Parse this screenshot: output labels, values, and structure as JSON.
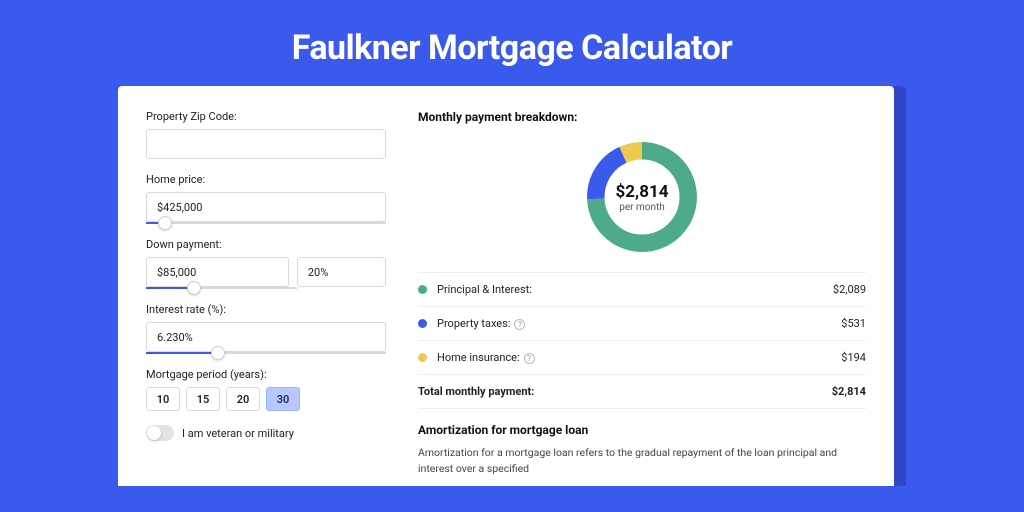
{
  "header": {
    "title": "Faulkner Mortgage Calculator"
  },
  "form": {
    "zip": {
      "label": "Property Zip Code:",
      "value": ""
    },
    "home_price": {
      "label": "Home price:",
      "value": "$425,000",
      "slider_pct": 8
    },
    "down_payment": {
      "label": "Down payment:",
      "value": "$85,000",
      "pct": "20%",
      "slider_pct": 20
    },
    "interest": {
      "label": "Interest rate (%):",
      "value": "6.230%",
      "slider_pct": 30
    },
    "period": {
      "label": "Mortgage period (years):",
      "options": [
        "10",
        "15",
        "20",
        "30"
      ],
      "selected": "30"
    },
    "veteran": {
      "label": "I am veteran or military"
    }
  },
  "breakdown": {
    "title": "Monthly payment breakdown:",
    "total": "$2,814",
    "sub": "per month",
    "items": [
      {
        "label": "Principal & Interest:",
        "value": "$2,089",
        "color": "#4eab8a",
        "info": false
      },
      {
        "label": "Property taxes:",
        "value": "$531",
        "color": "#3a59ed",
        "info": true
      },
      {
        "label": "Home insurance:",
        "value": "$194",
        "color": "#f0c94f",
        "info": true
      }
    ],
    "total_row": {
      "label": "Total monthly payment:",
      "value": "$2,814"
    }
  },
  "amort": {
    "title": "Amortization for mortgage loan",
    "text": "Amortization for a mortgage loan refers to the gradual repayment of the loan principal and interest over a specified"
  },
  "chart_data": {
    "type": "pie",
    "title": "Monthly payment breakdown",
    "categories": [
      "Principal & Interest",
      "Property taxes",
      "Home insurance"
    ],
    "values": [
      2089,
      531,
      194
    ],
    "colors": [
      "#4eab8a",
      "#3a59ed",
      "#f0c94f"
    ],
    "total": 2814,
    "ylabel": "per month"
  }
}
